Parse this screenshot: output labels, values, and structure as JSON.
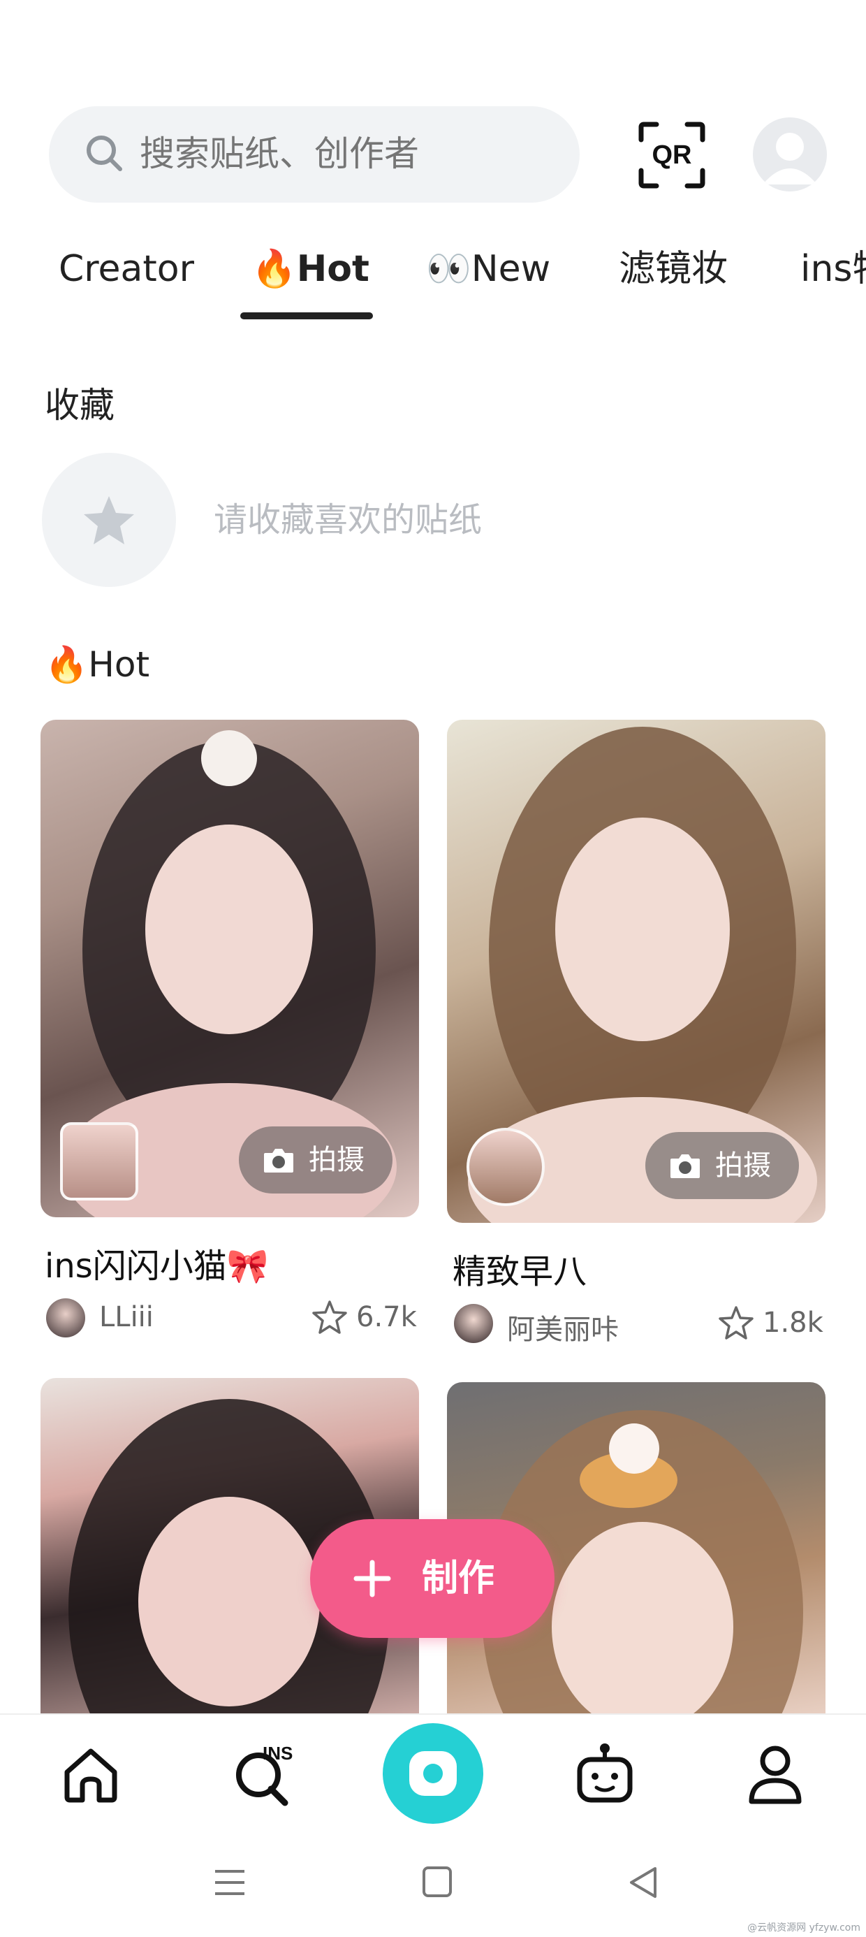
{
  "header": {
    "search_placeholder": "搜索贴纸、创作者",
    "qr_label": "QR"
  },
  "tabs": [
    {
      "label": "Creator"
    },
    {
      "label": "🔥Hot",
      "active": true
    },
    {
      "label": "👀New"
    },
    {
      "label": "滤镜妆"
    },
    {
      "label": "ins特"
    }
  ],
  "favorites": {
    "title": "收藏",
    "empty_text": "请收藏喜欢的贴纸"
  },
  "hot_section": {
    "title": "🔥Hot",
    "shoot_label": "拍摄",
    "cards": [
      {
        "title": "ins闪闪小猫🎀",
        "author": "LLiii",
        "likes": "6.7k"
      },
      {
        "title": "精致早八",
        "author": "阿美丽咔",
        "likes": "1.8k"
      }
    ]
  },
  "fab": {
    "label": "制作"
  },
  "bottom_nav": [
    "home-icon",
    "ins-search-icon",
    "camera-icon",
    "robot-icon",
    "profile-icon"
  ],
  "watermark": "@云帆资源网 yfzyw.com",
  "colors": {
    "accent_pink": "#f35b8a",
    "accent_teal": "#25d0d4",
    "text": "#222222",
    "muted": "#b9bcc1"
  }
}
